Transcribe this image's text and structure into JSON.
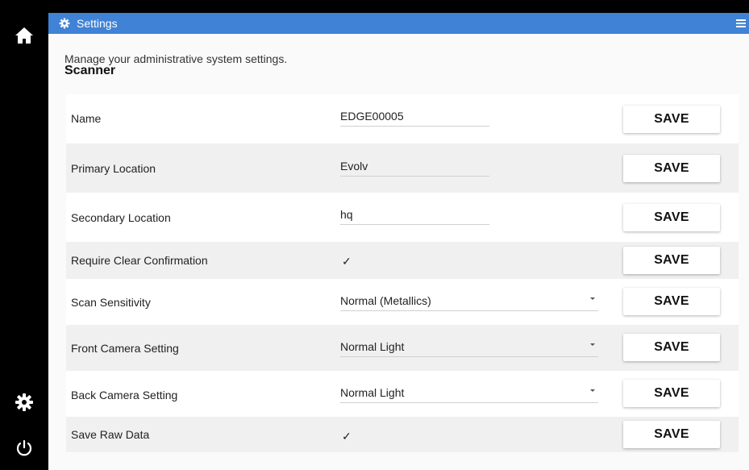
{
  "header": {
    "title": "Settings"
  },
  "page": {
    "description": "Manage your administrative system settings.",
    "section": "Scanner"
  },
  "rows": [
    {
      "label": "Name",
      "value": "EDGE00005",
      "kind": "text"
    },
    {
      "label": "Primary Location",
      "value": "Evolv",
      "kind": "text"
    },
    {
      "label": "Secondary Location",
      "value": "hq",
      "kind": "text"
    },
    {
      "label": "Require Clear Confirmation",
      "value": "✓",
      "kind": "check"
    },
    {
      "label": "Scan Sensitivity",
      "value": "Normal (Metallics)",
      "kind": "select"
    },
    {
      "label": "Front Camera Setting",
      "value": "Normal Light",
      "kind": "select"
    },
    {
      "label": "Back Camera Setting",
      "value": "Normal Light",
      "kind": "select"
    },
    {
      "label": "Save Raw Data",
      "value": "✓",
      "kind": "check"
    }
  ],
  "save_label": "SAVE",
  "icons": {
    "sidebar_top": "home-icon",
    "sidebar_bottom_1": "gear-icon",
    "sidebar_bottom_2": "power-icon",
    "header_left": "gear-icon",
    "header_right": "menu-icon"
  },
  "colors": {
    "header": "#3f82d6",
    "sidebar": "#000000"
  }
}
